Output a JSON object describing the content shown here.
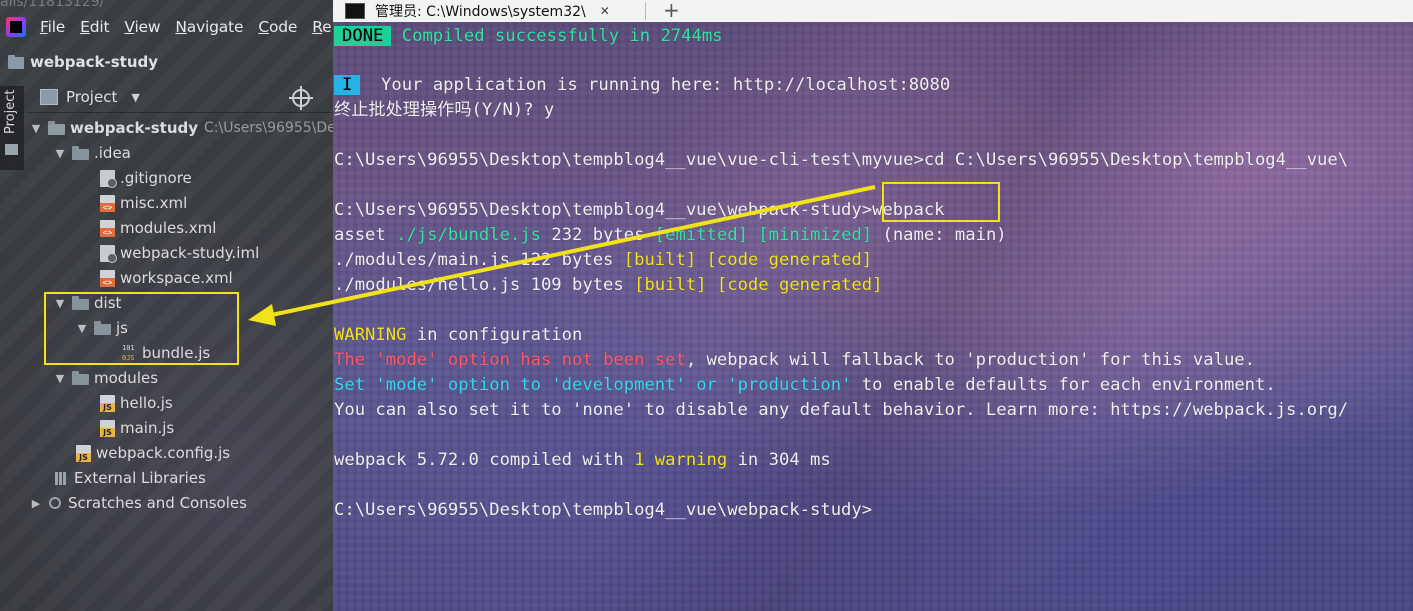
{
  "ide": {
    "breadcrumb_faded": "ails/11813129/",
    "menu": [
      {
        "label": "File",
        "u": "F",
        "rest": "ile"
      },
      {
        "label": "Edit",
        "u": "E",
        "rest": "dit"
      },
      {
        "label": "View",
        "u": "V",
        "rest": "iew"
      },
      {
        "label": "Navigate",
        "u": "N",
        "rest": "avigate"
      },
      {
        "label": "Code",
        "u": "C",
        "rest": "ode"
      },
      {
        "label": "Re",
        "u": "R",
        "rest": "e"
      }
    ],
    "project_title": "webpack-study",
    "side_tab_label": "Project",
    "project_dropdown_label": "Project",
    "tree": {
      "root_name": "webpack-study",
      "root_path": "C:\\Users\\96955\\De",
      "idea": ".idea",
      "gitignore": ".gitignore",
      "misc": "misc.xml",
      "modules_xml": "modules.xml",
      "iml": "webpack-study.iml",
      "workspace": "workspace.xml",
      "dist": "dist",
      "js": "js",
      "bundle": "bundle.js",
      "modules": "modules",
      "hello": "hello.js",
      "main": "main.js",
      "config": "webpack.config.js",
      "ext_libs": "External Libraries",
      "scratches": "Scratches and Consoles"
    }
  },
  "terminal": {
    "tab_title": "管理员: C:\\Windows\\system32\\",
    "lines": {
      "done_badge": "DONE",
      "done_text": " Compiled successfully in 2744ms",
      "i_badge": "I",
      "running": "  Your application is running here: http://localhost:8080",
      "terminate": "终止批处理操作吗(Y/N)? y",
      "cd_cmd": "C:\\Users\\96955\\Desktop\\tempblog4__vue\\vue-cli-test\\myvue>cd C:\\Users\\96955\\Desktop\\tempblog4__vue\\",
      "prompt1": "C:\\Users\\96955\\Desktop\\tempblog4__vue\\webpack-study>webpack",
      "asset_a": "asset ",
      "asset_path": "./js/bundle.js",
      "asset_b": " 232 bytes ",
      "emitted": "[emitted]",
      "minimized": "[minimized]",
      "asset_c": " (name: main)",
      "mod1_a": "./modules/main.js 122 bytes ",
      "built": "[built]",
      "codegen": "[code generated]",
      "mod2_a": "./modules/hello.js 109 bytes ",
      "warning_word": "WARNING",
      "warning_rest": " in configuration",
      "w1_a": "The ",
      "w1_mode": "'mode'",
      "w1_b": " option has not been set",
      "w1_c": ", webpack will fallback to 'production' for this value.",
      "w2_a": "Set ",
      "w2_mode": "'mode'",
      "w2_b": " option to ",
      "w2_dev": "'development'",
      "w2_or": " or ",
      "w2_prod": "'production'",
      "w2_c": " to enable defaults for each environment.",
      "w3": "You can also set it to 'none' to disable any default behavior. Learn more: https://webpack.js.org/",
      "compiled_a": "webpack 5.72.0 compiled with ",
      "compiled_warn": "1 warning",
      "compiled_b": " in 304 ms",
      "prompt2": "C:\\Users\\96955\\Desktop\\tempblog4__vue\\webpack-study>"
    }
  },
  "colors": {
    "annotation": "#f2e21a",
    "done_badge": "#1fd09a",
    "info_badge": "#27b2e6"
  }
}
